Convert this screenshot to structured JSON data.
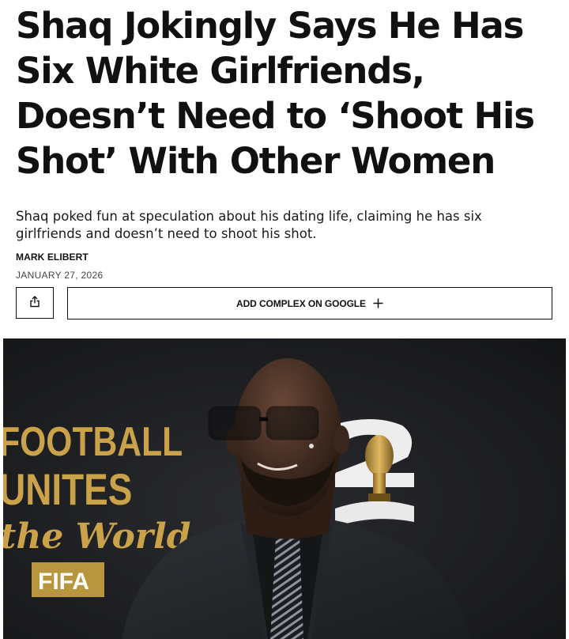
{
  "article": {
    "headline": "Shaq Jokingly Says He Has Six White Girlfriends, Doesn’t Need to ‘Shoot His Shot’ With Other Women",
    "dek": "Shaq poked fun at speculation about his dating life, claiming he has six girlfriends and doesn’t need to shoot his shot.",
    "author": "MARK ELIBERT",
    "date": "JANUARY 27, 2026"
  },
  "actions": {
    "share_icon": "share-icon",
    "google_label": "ADD COMPLEX ON GOOGLE",
    "google_icon": "plus-icon"
  },
  "hero": {
    "backdrop_text": {
      "line1": "FOOTBALL",
      "line2": "UNITES",
      "line3": "the World",
      "badge": "FIFA"
    },
    "colors": {
      "backdrop": "#1d1e21",
      "gold": "#c9a24a",
      "badge_bg": "#b8963f"
    }
  }
}
